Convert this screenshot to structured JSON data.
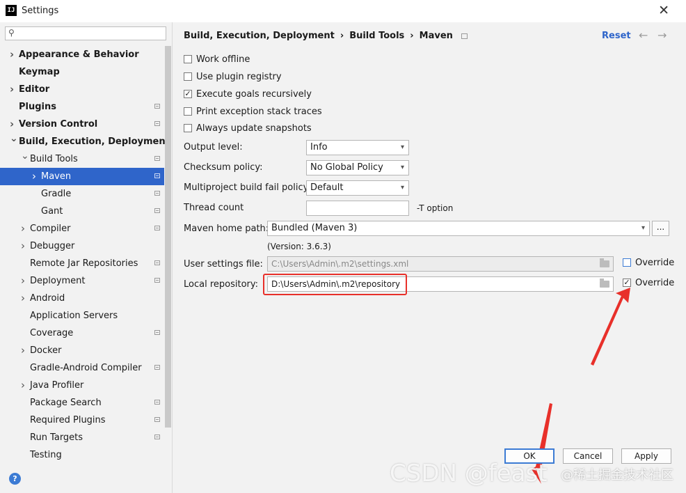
{
  "window": {
    "title": "Settings",
    "app_icon": "IJ"
  },
  "sidebar": {
    "search_placeholder": "",
    "items": [
      {
        "label": "Appearance & Behavior",
        "bold": true,
        "arrow": "right",
        "indent": 0,
        "proj": false
      },
      {
        "label": "Keymap",
        "bold": true,
        "arrow": "",
        "indent": 0,
        "proj": false
      },
      {
        "label": "Editor",
        "bold": true,
        "arrow": "right",
        "indent": 0,
        "proj": false
      },
      {
        "label": "Plugins",
        "bold": true,
        "arrow": "",
        "indent": 0,
        "proj": true
      },
      {
        "label": "Version Control",
        "bold": true,
        "arrow": "right",
        "indent": 0,
        "proj": true
      },
      {
        "label": "Build, Execution, Deployment",
        "bold": true,
        "arrow": "down",
        "indent": 0,
        "proj": false
      },
      {
        "label": "Build Tools",
        "bold": false,
        "arrow": "down",
        "indent": 1,
        "proj": true
      },
      {
        "label": "Maven",
        "bold": false,
        "arrow": "right",
        "indent": 2,
        "proj": true,
        "selected": true
      },
      {
        "label": "Gradle",
        "bold": false,
        "arrow": "",
        "indent": 2,
        "proj": true
      },
      {
        "label": "Gant",
        "bold": false,
        "arrow": "",
        "indent": 2,
        "proj": true
      },
      {
        "label": "Compiler",
        "bold": false,
        "arrow": "right",
        "indent": 1,
        "proj": true
      },
      {
        "label": "Debugger",
        "bold": false,
        "arrow": "right",
        "indent": 1,
        "proj": false
      },
      {
        "label": "Remote Jar Repositories",
        "bold": false,
        "arrow": "",
        "indent": 1,
        "proj": true
      },
      {
        "label": "Deployment",
        "bold": false,
        "arrow": "right",
        "indent": 1,
        "proj": true
      },
      {
        "label": "Android",
        "bold": false,
        "arrow": "right",
        "indent": 1,
        "proj": false
      },
      {
        "label": "Application Servers",
        "bold": false,
        "arrow": "",
        "indent": 1,
        "proj": false
      },
      {
        "label": "Coverage",
        "bold": false,
        "arrow": "",
        "indent": 1,
        "proj": true
      },
      {
        "label": "Docker",
        "bold": false,
        "arrow": "right",
        "indent": 1,
        "proj": false
      },
      {
        "label": "Gradle-Android Compiler",
        "bold": false,
        "arrow": "",
        "indent": 1,
        "proj": true
      },
      {
        "label": "Java Profiler",
        "bold": false,
        "arrow": "right",
        "indent": 1,
        "proj": false
      },
      {
        "label": "Package Search",
        "bold": false,
        "arrow": "",
        "indent": 1,
        "proj": true
      },
      {
        "label": "Required Plugins",
        "bold": false,
        "arrow": "",
        "indent": 1,
        "proj": true
      },
      {
        "label": "Run Targets",
        "bold": false,
        "arrow": "",
        "indent": 1,
        "proj": true
      },
      {
        "label": "Testing",
        "bold": false,
        "arrow": "",
        "indent": 1,
        "proj": false
      }
    ]
  },
  "breadcrumb": [
    "Build, Execution, Deployment",
    "Build Tools",
    "Maven"
  ],
  "reset_label": "Reset",
  "checkboxes": [
    {
      "label": "Work offline",
      "checked": false
    },
    {
      "label": "Use plugin registry",
      "checked": false
    },
    {
      "label": "Execute goals recursively",
      "checked": true
    },
    {
      "label": "Print exception stack traces",
      "checked": false
    },
    {
      "label": "Always update snapshots",
      "checked": false
    }
  ],
  "fields": {
    "output_level": {
      "label": "Output level:",
      "value": "Info"
    },
    "checksum_policy": {
      "label": "Checksum policy:",
      "value": "No Global Policy"
    },
    "multiproject": {
      "label": "Multiproject build fail policy:",
      "value": "Default"
    },
    "thread_count": {
      "label": "Thread count",
      "value": "",
      "suffix": "-T option"
    },
    "maven_home": {
      "label": "Maven home path:",
      "value": "Bundled (Maven 3)",
      "browse": "..."
    },
    "version": "(Version: 3.6.3)",
    "user_settings": {
      "label": "User settings file:",
      "value": "C:\\Users\\Admin\\.m2\\settings.xml",
      "override_label": "Override",
      "override": false
    },
    "local_repo": {
      "label": "Local repository:",
      "value": "D:\\Users\\Admin\\.m2\\repository",
      "override_label": "Override",
      "override": true
    }
  },
  "buttons": {
    "ok": "OK",
    "cancel": "Cancel",
    "apply": "Apply"
  },
  "watermark": {
    "left": "CSDN @feast",
    "right": "@稀土掘金技术社区"
  },
  "colors": {
    "accent": "#2f65ca",
    "annotation": "#e8302a"
  }
}
